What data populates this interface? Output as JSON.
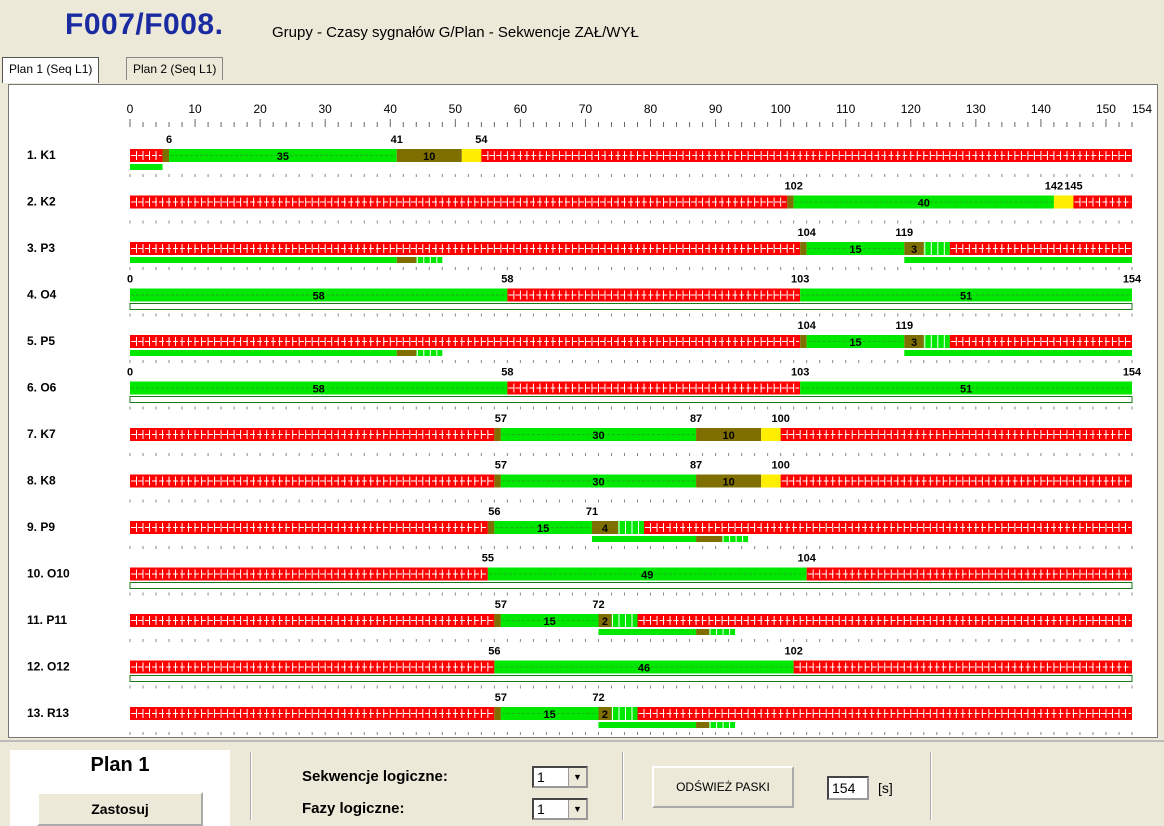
{
  "header": {
    "title": "F007/F008.",
    "subtitle": "Grupy - Czasy sygnałów G/Plan - Sekwencje ZAŁ/WYŁ"
  },
  "tabs": [
    {
      "label": "Plan 1 (Seq L1)",
      "active": true
    },
    {
      "label": "Plan 2 (Seq L1)",
      "active": false
    }
  ],
  "timeline": {
    "cycle": 154,
    "major_ticks": [
      0,
      10,
      20,
      30,
      40,
      50,
      60,
      70,
      80,
      90,
      100,
      110,
      120,
      130,
      140,
      150,
      154
    ]
  },
  "colors": {
    "red": "#ff0000",
    "green": "#00e800",
    "amber": "#7f6f00",
    "yellow": "#ffee00",
    "white": "#ffffff"
  },
  "groups": [
    {
      "name": "1. K1",
      "labels": [
        [
          "6",
          6
        ],
        [
          "41",
          41
        ],
        [
          "54",
          54
        ]
      ],
      "segments": [
        [
          "red",
          0,
          5
        ],
        [
          "amber",
          5,
          6
        ],
        [
          "green",
          6,
          41,
          "35"
        ],
        [
          "amber",
          41,
          51,
          "10"
        ],
        [
          "yellow",
          51,
          54
        ],
        [
          "red",
          54,
          154
        ]
      ],
      "sub": [
        [
          "green",
          0,
          5
        ]
      ],
      "box": false
    },
    {
      "name": "2. K2",
      "labels": [
        [
          "102",
          102
        ],
        [
          "142",
          142
        ],
        [
          "145",
          145
        ]
      ],
      "segments": [
        [
          "red",
          0,
          101
        ],
        [
          "amber",
          101,
          102
        ],
        [
          "green",
          102,
          142,
          "40"
        ],
        [
          "yellow",
          142,
          145
        ],
        [
          "red",
          145,
          154
        ]
      ],
      "sub": [],
      "box": false
    },
    {
      "name": "3. P3",
      "labels": [
        [
          "104",
          104
        ],
        [
          "119",
          119
        ]
      ],
      "segments": [
        [
          "red",
          0,
          103
        ],
        [
          "amber",
          103,
          104
        ],
        [
          "green",
          104,
          119,
          "15"
        ],
        [
          "amber",
          119,
          122,
          "3"
        ],
        [
          "greenblink",
          122,
          126
        ],
        [
          "red",
          126,
          154
        ]
      ],
      "sub": [
        [
          "green",
          0,
          41
        ],
        [
          "amber",
          41,
          44
        ],
        [
          "greenblink",
          44,
          48
        ],
        [
          "green",
          119,
          154
        ]
      ],
      "box": false
    },
    {
      "name": "4. O4",
      "labels": [
        [
          "0",
          0
        ],
        [
          "58",
          58
        ],
        [
          "103",
          103
        ],
        [
          "154",
          154
        ]
      ],
      "segments": [
        [
          "green",
          0,
          58,
          "58"
        ],
        [
          "red",
          58,
          103
        ],
        [
          "green",
          103,
          154,
          "51"
        ]
      ],
      "sub": [],
      "box": true
    },
    {
      "name": "5. P5",
      "labels": [
        [
          "104",
          104
        ],
        [
          "119",
          119
        ]
      ],
      "segments": [
        [
          "red",
          0,
          103
        ],
        [
          "amber",
          103,
          104
        ],
        [
          "green",
          104,
          119,
          "15"
        ],
        [
          "amber",
          119,
          122,
          "3"
        ],
        [
          "greenblink",
          122,
          126
        ],
        [
          "red",
          126,
          154
        ]
      ],
      "sub": [
        [
          "green",
          0,
          41
        ],
        [
          "amber",
          41,
          44
        ],
        [
          "greenblink",
          44,
          48
        ],
        [
          "green",
          119,
          154
        ]
      ],
      "box": false
    },
    {
      "name": "6. O6",
      "labels": [
        [
          "0",
          0
        ],
        [
          "58",
          58
        ],
        [
          "103",
          103
        ],
        [
          "154",
          154
        ]
      ],
      "segments": [
        [
          "green",
          0,
          58,
          "58"
        ],
        [
          "red",
          58,
          103
        ],
        [
          "green",
          103,
          154,
          "51"
        ]
      ],
      "sub": [],
      "box": true
    },
    {
      "name": "7. K7",
      "labels": [
        [
          "57",
          57
        ],
        [
          "87",
          87
        ],
        [
          "100",
          100
        ]
      ],
      "segments": [
        [
          "red",
          0,
          56
        ],
        [
          "amber",
          56,
          57
        ],
        [
          "green",
          57,
          87,
          "30"
        ],
        [
          "amber",
          87,
          97,
          "10"
        ],
        [
          "yellow",
          97,
          100
        ],
        [
          "red",
          100,
          154
        ]
      ],
      "sub": [],
      "box": false
    },
    {
      "name": "8. K8",
      "labels": [
        [
          "57",
          57
        ],
        [
          "87",
          87
        ],
        [
          "100",
          100
        ]
      ],
      "segments": [
        [
          "red",
          0,
          56
        ],
        [
          "amber",
          56,
          57
        ],
        [
          "green",
          57,
          87,
          "30"
        ],
        [
          "amber",
          87,
          97,
          "10"
        ],
        [
          "yellow",
          97,
          100
        ],
        [
          "red",
          100,
          154
        ]
      ],
      "sub": [],
      "box": false
    },
    {
      "name": "9. P9",
      "labels": [
        [
          "56",
          56
        ],
        [
          "71",
          71
        ]
      ],
      "segments": [
        [
          "red",
          0,
          55
        ],
        [
          "amber",
          55,
          56
        ],
        [
          "green",
          56,
          71,
          "15"
        ],
        [
          "amber",
          71,
          75,
          "4"
        ],
        [
          "greenblink",
          75,
          79
        ],
        [
          "red",
          79,
          154
        ]
      ],
      "sub": [
        [
          "green",
          71,
          87
        ],
        [
          "amber",
          87,
          91
        ],
        [
          "greenblink",
          91,
          95
        ]
      ],
      "box": false
    },
    {
      "name": "10. O10",
      "labels": [
        [
          "55",
          55
        ],
        [
          "104",
          104
        ]
      ],
      "segments": [
        [
          "red",
          0,
          55
        ],
        [
          "green",
          55,
          104,
          "49"
        ],
        [
          "red",
          104,
          154
        ]
      ],
      "sub": [],
      "box": true
    },
    {
      "name": "11. P11",
      "labels": [
        [
          "57",
          57
        ],
        [
          "72",
          72
        ]
      ],
      "segments": [
        [
          "red",
          0,
          56
        ],
        [
          "amber",
          56,
          57
        ],
        [
          "green",
          57,
          72,
          "15"
        ],
        [
          "amber",
          72,
          74,
          "2"
        ],
        [
          "greenblink",
          74,
          78
        ],
        [
          "red",
          78,
          154
        ]
      ],
      "sub": [
        [
          "green",
          72,
          87
        ],
        [
          "amber",
          87,
          89
        ],
        [
          "greenblink",
          89,
          93
        ]
      ],
      "box": false
    },
    {
      "name": "12. O12",
      "labels": [
        [
          "56",
          56
        ],
        [
          "102",
          102
        ]
      ],
      "segments": [
        [
          "red",
          0,
          56
        ],
        [
          "green",
          56,
          102,
          "46"
        ],
        [
          "red",
          102,
          154
        ]
      ],
      "sub": [],
      "box": true
    },
    {
      "name": "13. R13",
      "labels": [
        [
          "57",
          57
        ],
        [
          "72",
          72
        ]
      ],
      "segments": [
        [
          "red",
          0,
          56
        ],
        [
          "amber",
          56,
          57
        ],
        [
          "green",
          57,
          72,
          "15"
        ],
        [
          "amber",
          72,
          74,
          "2"
        ],
        [
          "greenblink",
          74,
          78
        ],
        [
          "red",
          78,
          154
        ]
      ],
      "sub": [
        [
          "green",
          72,
          87
        ],
        [
          "amber",
          87,
          89
        ],
        [
          "greenblink",
          89,
          93
        ]
      ],
      "box": false
    }
  ],
  "footer": {
    "plan_title": "Plan 1",
    "apply_label": "Zastosuj",
    "seq_label": "Sekwencje logiczne:",
    "seq_value": "1",
    "phase_label": "Fazy logiczne:",
    "phase_value": "1",
    "refresh_label": "ODŚWIEŻ PASKI",
    "seconds_value": "154",
    "seconds_unit": "[s]"
  }
}
